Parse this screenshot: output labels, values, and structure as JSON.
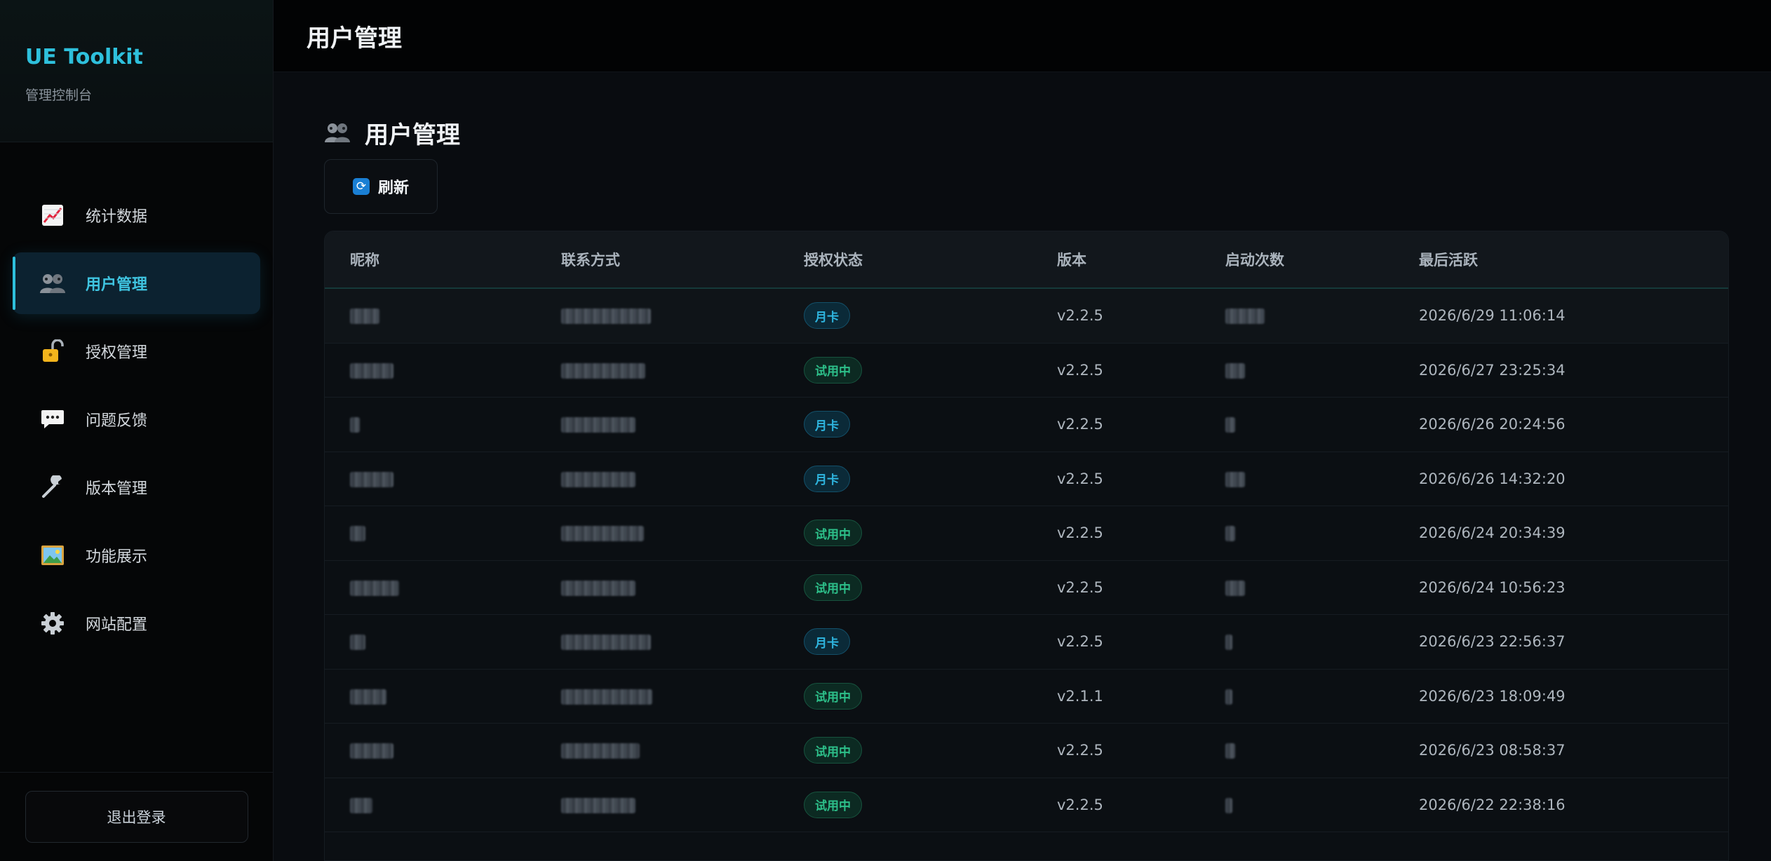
{
  "sidebar": {
    "brand_title": "UE Toolkit",
    "brand_subtitle": "管理控制台",
    "items": [
      {
        "label": "统计数据",
        "icon": "chart-increasing-icon"
      },
      {
        "label": "用户管理",
        "icon": "users-icon",
        "active": true
      },
      {
        "label": "授权管理",
        "icon": "unlocked-lock-icon"
      },
      {
        "label": "问题反馈",
        "icon": "speech-bubble-icon"
      },
      {
        "label": "版本管理",
        "icon": "wrench-icon"
      },
      {
        "label": "功能展示",
        "icon": "framed-picture-icon"
      },
      {
        "label": "网站配置",
        "icon": "gear-icon"
      }
    ],
    "logout_label": "退出登录"
  },
  "header": {
    "title": "用户管理"
  },
  "main": {
    "section_title": "用户管理",
    "section_icon": "users-icon",
    "refresh_label": "刷新",
    "refresh_icon": "refresh-icon",
    "table": {
      "columns": [
        "昵称",
        "联系方式",
        "授权状态",
        "版本",
        "启动次数",
        "最后活跃"
      ],
      "rows": [
        {
          "status": "月卡",
          "version": "v2.2.5",
          "last_active": "2026/6/29 11:06:14"
        },
        {
          "status": "试用中",
          "version": "v2.2.5",
          "last_active": "2026/6/27 23:25:34"
        },
        {
          "status": "月卡",
          "version": "v2.2.5",
          "last_active": "2026/6/26 20:24:56"
        },
        {
          "status": "月卡",
          "version": "v2.2.5",
          "last_active": "2026/6/26 14:32:20"
        },
        {
          "status": "试用中",
          "version": "v2.2.5",
          "last_active": "2026/6/24 20:34:39"
        },
        {
          "status": "试用中",
          "version": "v2.2.5",
          "last_active": "2026/6/24 10:56:23"
        },
        {
          "status": "月卡",
          "version": "v2.2.5",
          "last_active": "2026/6/23 22:56:37"
        },
        {
          "status": "试用中",
          "version": "v2.1.1",
          "last_active": "2026/6/23 18:09:49"
        },
        {
          "status": "试用中",
          "version": "v2.2.5",
          "last_active": "2026/6/23 08:58:37"
        },
        {
          "status": "试用中",
          "version": "v2.2.5",
          "last_active": "2026/6/22 22:38:16"
        }
      ]
    }
  },
  "colors": {
    "accent": "#2ec0dc",
    "badge_month": "#2fb6e0",
    "badge_trial": "#2dc08a"
  }
}
